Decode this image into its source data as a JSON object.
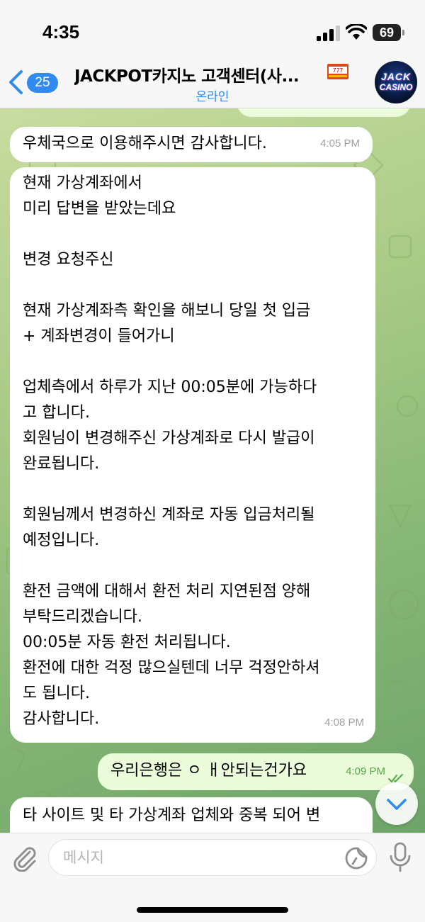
{
  "status_bar": {
    "time": "4:35",
    "battery": "69"
  },
  "header": {
    "back_count": "25",
    "title": "JACKPOT카지노 고객센터(사...",
    "status": "온라인",
    "avatar_line1": "JACK",
    "avatar_line2": "CASINO"
  },
  "messages": [
    {
      "direction": "in",
      "text": "우체국으로 이용해주시면 감사합니다.",
      "time": "4:05 PM"
    },
    {
      "direction": "in",
      "text": "현재 가상계좌에서\n미리 답변을 받았는데요\n\n변경 요청주신\n\n현재 가상계좌측 확인을 해보니 당일 첫 입금\n+ 계좌변경이 들어가니\n\n업체측에서 하루가 지난 00:05분에 가능하다\n고 합니다.\n회원님이 변경해주신 가상계좌로 다시 발급이\n완료됩니다.\n\n회원님께서 변경하신 계좌로 자동 입금처리될\n예정입니다.\n\n환전 금액에 대해서 환전 처리 지연된점 양해\n부탁드리겠습니다.\n00:05분 자동 환전 처리됩니다.\n환전에 대한 걱정 많으실텐데 너무 걱정안하셔\n도 됩니다.\n감사합니다.",
      "time": "4:08 PM"
    },
    {
      "direction": "out",
      "text": "우리은행은 ㅇ ㅐ안되는건가요",
      "time": "4:09 PM"
    },
    {
      "direction": "in",
      "text": "타 사이트 및 타 가상계좌 업체와 중복 되어 변"
    }
  ],
  "input": {
    "placeholder": "메시지"
  },
  "colors": {
    "accent": "#2f8bef",
    "outgoing_bubble": "#eafcd9",
    "outgoing_time": "#56a944",
    "chat_bg": "#a9cb86"
  },
  "icons": [
    "signal-icon",
    "wifi-icon",
    "battery-icon",
    "back-chevron-icon",
    "slot-machine-icon",
    "double-check-icon",
    "chevron-down-icon",
    "paperclip-icon",
    "sticker-icon",
    "microphone-icon"
  ]
}
